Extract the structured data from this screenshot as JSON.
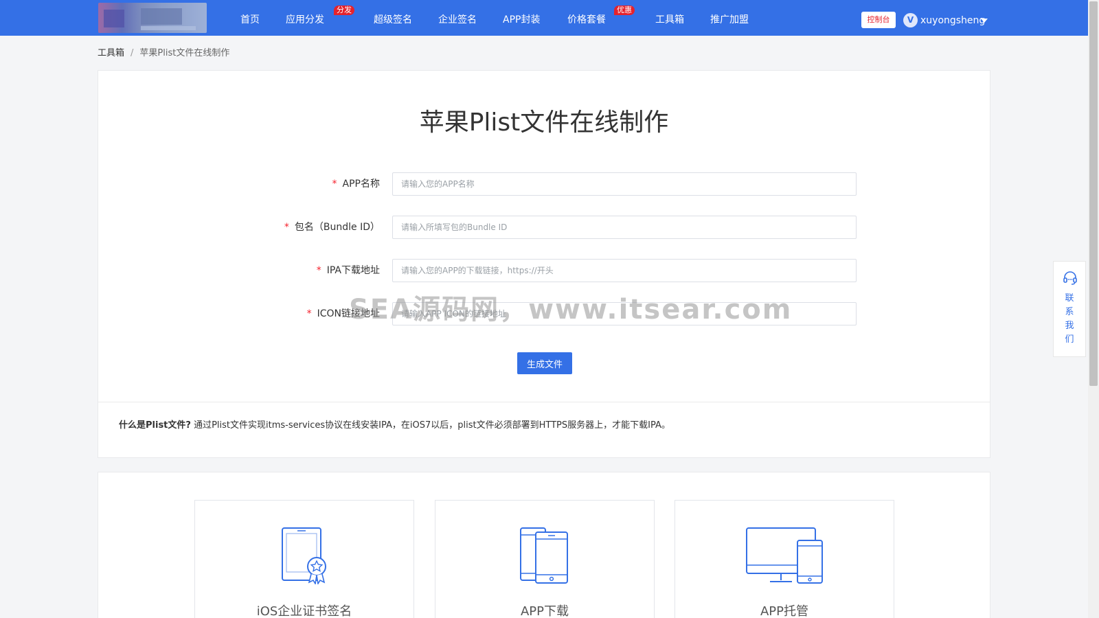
{
  "nav": {
    "items": [
      {
        "label": "首页"
      },
      {
        "label": "应用分发",
        "badge": "分发"
      },
      {
        "label": "超级签名"
      },
      {
        "label": "企业签名"
      },
      {
        "label": "APP封装"
      },
      {
        "label": "价格套餐",
        "badge": "优惠"
      },
      {
        "label": "工具箱"
      },
      {
        "label": "推广加盟"
      }
    ],
    "console_label": "控制台",
    "avatar_letter": "V",
    "username": "xuyongsheng"
  },
  "breadcrumb": {
    "parent": "工具箱",
    "separator": "/",
    "current": "苹果Plist文件在线制作"
  },
  "form": {
    "title": "苹果Plist文件在线制作",
    "required_mark": "*",
    "fields": [
      {
        "label": "APP名称",
        "placeholder": "请输入您的APP名称",
        "value": ""
      },
      {
        "label": "包名（Bundle ID）",
        "placeholder": "请输入所填写包的Bundle ID",
        "value": ""
      },
      {
        "label": "IPA下载地址",
        "placeholder": "请输入您的APP的下载链接，https://开头",
        "value": ""
      },
      {
        "label": "ICON链接地址",
        "placeholder": "请输入APP ICON的链接地址",
        "value": ""
      }
    ],
    "submit_label": "生成文件"
  },
  "description": {
    "title": "什么是Plist文件?",
    "text": " 通过Plist文件实现itms-services协议在线安装IPA，在iOS7以后，plist文件必须部署到HTTPS服务器上，才能下载IPA。"
  },
  "watermark": "SEA源码网，www.itsear.com",
  "contact": {
    "label": "联系我们"
  },
  "features": [
    {
      "label": "iOS企业证书签名",
      "icon": "tablet-certificate-icon"
    },
    {
      "label": "APP下载",
      "icon": "phones-icon"
    },
    {
      "label": "APP托管",
      "icon": "monitor-phone-icon"
    }
  ],
  "colors": {
    "primary": "#3470e6",
    "badge": "#e5222d",
    "required": "#f5222d"
  }
}
